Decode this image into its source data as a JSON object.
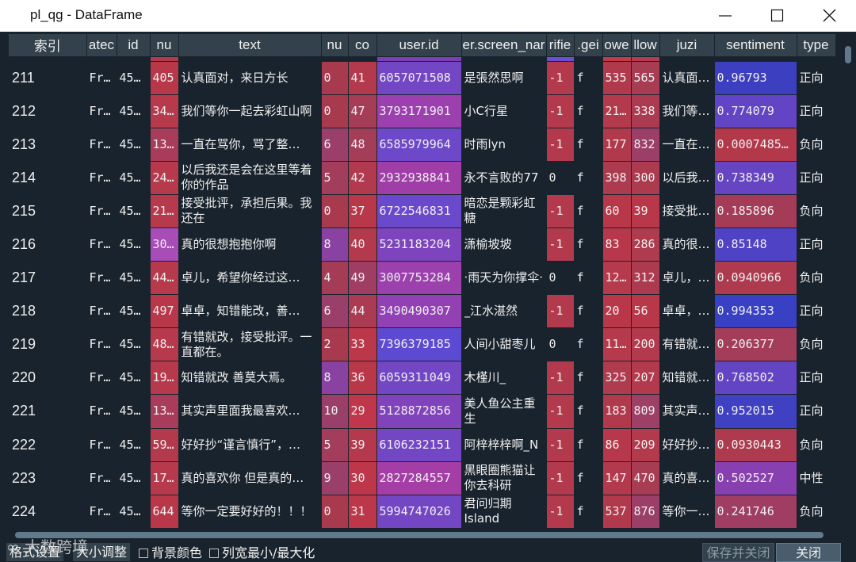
{
  "window": {
    "title": "pl_qg - DataFrame"
  },
  "table": {
    "headers": [
      "索引",
      "atec",
      "id",
      "nu",
      "text",
      "nu",
      "co",
      "user.id",
      "er.screen_nar",
      "rifie",
      ".gei",
      "owe",
      "llow",
      "juzi",
      "sentiment",
      "type"
    ],
    "top_row_colors": [
      "#19232d",
      "#19232d",
      "#19232d",
      "#b33a4c",
      "#19232d",
      "#19232d",
      "#19232d",
      "#7a3fb3",
      "#19232d",
      "#6a4fd0",
      "#19232d",
      "#c03c4a",
      "#b43b4f",
      "#19232d",
      "#19232d",
      "#19232d"
    ],
    "rows": [
      {
        "idx": "211",
        "c1": "Fr…",
        "c2": "45…",
        "c3": "405",
        "c4": "认真面对，来日方长",
        "c5": "0",
        "c6": "41",
        "c7": "6057071508",
        "c8": "是張然思啊",
        "c9": "-1",
        "c10": "f",
        "c11": "535",
        "c12": "565",
        "c13": "认真面…",
        "c14": "0.96793",
        "c15": "正向",
        "colors": {
          "c3": "#b8384a",
          "c5": "#a83a4e",
          "c6": "#b23a4c",
          "c7": "#7346c4",
          "c9": "#b23a4c",
          "c11": "#b03a4c",
          "c12": "#a83c52",
          "c14": "#3b3fc0"
        }
      },
      {
        "idx": "212",
        "c1": "Fr…",
        "c2": "45…",
        "c3": "34…",
        "c4": "我们等你一起去彩虹山啊",
        "c5": "0",
        "c6": "47",
        "c7": "3793171901",
        "c8": "小C行星",
        "c9": "-1",
        "c10": "f",
        "c11": "21…",
        "c12": "338",
        "c13": "我们等…",
        "c14": "0.774079",
        "c15": "正向",
        "colors": {
          "c3": "#b63a4c",
          "c5": "#a83a4e",
          "c6": "#a53d56",
          "c7": "#9c40b0",
          "c9": "#b23a4c",
          "c11": "#b23a4c",
          "c12": "#ab3b50",
          "c14": "#6245c4"
        }
      },
      {
        "idx": "213",
        "c1": "Fr…",
        "c2": "45…",
        "c3": "13…",
        "c4": "一直在骂你，骂了整…",
        "c5": "6",
        "c6": "48",
        "c7": "6585979964",
        "c8": "时雨lyn",
        "c9": "-1",
        "c10": "f",
        "c11": "177",
        "c12": "832",
        "c13": "一直在…",
        "c14": "0.0007485…",
        "c15": "负向",
        "colors": {
          "c3": "#a83c5a",
          "c5": "#9a3f6a",
          "c6": "#a33d58",
          "c7": "#6d48c8",
          "c9": "#b23a4c",
          "c11": "#b03a4c",
          "c12": "#9c3f68",
          "c14": "#b2384a"
        }
      },
      {
        "idx": "214",
        "c1": "Fr…",
        "c2": "45…",
        "c3": "24…",
        "c4": "以后我还是会在这里等着你的作品",
        "c5": "5",
        "c6": "42",
        "c7": "2932938841",
        "c8": "永不言败的77",
        "c9": "0",
        "c10": "f",
        "c11": "398",
        "c12": "300",
        "c13": "以后我…",
        "c14": "0.738349",
        "c15": "正向",
        "colors": {
          "c3": "#b63a4c",
          "c5": "#a23d5c",
          "c6": "#b13a4e",
          "c7": "#a03ea8",
          "c9": "#19232d",
          "c11": "#ac3b50",
          "c12": "#ac3b50",
          "c14": "#6745c2"
        }
      },
      {
        "idx": "215",
        "c1": "Fr…",
        "c2": "45…",
        "c3": "21…",
        "c4": "接受批评，承担后果。我还在",
        "c5": "0",
        "c6": "37",
        "c7": "6722546831",
        "c8": "暗恋是颗彩虹糖",
        "c9": "-1",
        "c10": "f",
        "c11": "60",
        "c12": "39",
        "c13": "接受批…",
        "c14": "0.185896",
        "c15": "负向",
        "colors": {
          "c3": "#b63a4c",
          "c5": "#a83a4e",
          "c6": "#b8384a",
          "c7": "#6a49cc",
          "c9": "#b23a4c",
          "c11": "#b8384a",
          "c12": "#b8384a",
          "c14": "#a43c58"
        }
      },
      {
        "idx": "216",
        "c1": "Fr…",
        "c2": "45…",
        "c3": "30…",
        "c4": "真的很想抱抱你啊",
        "c5": "8",
        "c6": "40",
        "c7": "5231183204",
        "c8": "潇榆坡坡",
        "c9": "-1",
        "c10": "f",
        "c11": "83",
        "c12": "286",
        "c13": "真的很…",
        "c14": "0.85148",
        "c15": "正向",
        "colors": {
          "c3": "#a84cb8",
          "c5": "#8a42a2",
          "c6": "#b23a4c",
          "c7": "#7e44bd",
          "c9": "#b23a4c",
          "c11": "#b6384a",
          "c12": "#ae3b4e",
          "c14": "#5042c4"
        }
      },
      {
        "idx": "217",
        "c1": "Fr…",
        "c2": "45…",
        "c3": "44…",
        "c4": "卓儿，希望你经过这…",
        "c5": "4",
        "c6": "49",
        "c7": "3007753284",
        "c8": "·雨天为你撑伞·",
        "c9": "0",
        "c10": "f",
        "c11": "12…",
        "c12": "312",
        "c13": "卓儿，…",
        "c14": "0.0940966",
        "c15": "负向",
        "colors": {
          "c3": "#b63a4c",
          "c5": "#a53c55",
          "c6": "#9f3e62",
          "c7": "#9c40ae",
          "c9": "#19232d",
          "c11": "#b43a4c",
          "c12": "#ad3b4f",
          "c14": "#ad3a4e"
        }
      },
      {
        "idx": "218",
        "c1": "Fr…",
        "c2": "45…",
        "c3": "497",
        "c4": "卓卓，知错能改，善…",
        "c5": "6",
        "c6": "44",
        "c7": "3490490307",
        "c8": "_江水湛然",
        "c9": "-1",
        "c10": "f",
        "c11": "20",
        "c12": "56",
        "c13": "卓卓，…",
        "c14": "0.994353",
        "c15": "正向",
        "colors": {
          "c3": "#b8384a",
          "c5": "#9a3f6a",
          "c6": "#ab3b52",
          "c7": "#9141b4",
          "c9": "#b23a4c",
          "c11": "#b8384a",
          "c12": "#b8384a",
          "c14": "#3840c4"
        }
      },
      {
        "idx": "219",
        "c1": "Fr…",
        "c2": "45…",
        "c3": "48…",
        "c4": "有错就改，接受批评。一直都在。",
        "c5": "2",
        "c6": "33",
        "c7": "7396379185",
        "c8": "人间小甜枣儿",
        "c9": "0",
        "c10": "f",
        "c11": "11…",
        "c12": "200",
        "c13": "有错就…",
        "c14": "0.206377",
        "c15": "负向",
        "colors": {
          "c3": "#b63a4c",
          "c5": "#a83a4e",
          "c6": "#bc374a",
          "c7": "#5c4ad2",
          "c9": "#19232d",
          "c11": "#b43a4c",
          "c12": "#b23a4c",
          "c14": "#a33d5a"
        }
      },
      {
        "idx": "220",
        "c1": "Fr…",
        "c2": "45…",
        "c3": "19…",
        "c4": "知错就改 善莫大焉。",
        "c5": "8",
        "c6": "36",
        "c7": "6059311049",
        "c8": "木槿川_",
        "c9": "-1",
        "c10": "f",
        "c11": "325",
        "c12": "207",
        "c13": "知错就…",
        "c14": "0.768502",
        "c15": "正向",
        "colors": {
          "c3": "#b63a4c",
          "c5": "#8a42a2",
          "c6": "#b8384a",
          "c7": "#7346c4",
          "c9": "#b23a4c",
          "c11": "#ae3b4e",
          "c12": "#b23a4c",
          "c14": "#6345c4"
        }
      },
      {
        "idx": "221",
        "c1": "Fr…",
        "c2": "45…",
        "c3": "13…",
        "c4": "其实声里面我最喜欢…",
        "c5": "10",
        "c6": "29",
        "c7": "5128872856",
        "c8": "美人鱼公主重生",
        "c9": "-1",
        "c10": "f",
        "c11": "183",
        "c12": "809",
        "c13": "其实声…",
        "c14": "0.952015",
        "c15": "正向",
        "colors": {
          "c3": "#a83c5a",
          "c5": "#9a3f6a",
          "c6": "#c0364a",
          "c7": "#8143bb",
          "c9": "#b23a4c",
          "c11": "#b03a4c",
          "c12": "#9e3f66",
          "c14": "#3f40c2"
        }
      },
      {
        "idx": "222",
        "c1": "Fr…",
        "c2": "45…",
        "c3": "59…",
        "c4": "好好抄“谨言慎行”，…",
        "c5": "5",
        "c6": "39",
        "c7": "6106232151",
        "c8": "阿梓梓梓啊_N",
        "c9": "-1",
        "c10": "f",
        "c11": "86",
        "c12": "209",
        "c13": "好好抄…",
        "c14": "0.0930443",
        "c15": "负向",
        "colors": {
          "c3": "#b23a4c",
          "c5": "#a23d5c",
          "c6": "#b4394c",
          "c7": "#7346c4",
          "c9": "#b23a4c",
          "c11": "#b6384a",
          "c12": "#b23a4c",
          "c14": "#ad3a4e"
        }
      },
      {
        "idx": "223",
        "c1": "Fr…",
        "c2": "45…",
        "c3": "17…",
        "c4": "真的喜欢你 但是真的…",
        "c5": "9",
        "c6": "30",
        "c7": "2827284557",
        "c8": "黑眼圈熊猫让你去科研",
        "c9": "-1",
        "c10": "f",
        "c11": "147",
        "c12": "470",
        "c13": "真的喜…",
        "c14": "0.502527",
        "c15": "中性",
        "colors": {
          "c3": "#b63a4c",
          "c5": "#9a3f6a",
          "c6": "#be364a",
          "c7": "#a43ea6",
          "c9": "#b23a4c",
          "c11": "#b23a4c",
          "c12": "#a83c52",
          "c14": "#8840b0"
        }
      },
      {
        "idx": "224",
        "c1": "Fr…",
        "c2": "45…",
        "c3": "644",
        "c4": "等你一定要好好的！！！",
        "c5": "0",
        "c6": "31",
        "c7": "5994747026",
        "c8": "君问归期Island",
        "c9": "-1",
        "c10": "f",
        "c11": "537",
        "c12": "876",
        "c13": "等你一…",
        "c14": "0.241746",
        "c15": "负向",
        "colors": {
          "c3": "#b8384a",
          "c5": "#a83a4e",
          "c6": "#bc374a",
          "c7": "#7346c4",
          "c9": "#b23a4c",
          "c11": "#b03a4c",
          "c12": "#9c3f68",
          "c14": "#9f3e62"
        }
      }
    ]
  },
  "bottom": {
    "format_btn": "格式设置",
    "resize_btn": "大小调整",
    "bg_color_label": "背景颜色",
    "colwidth_label": "列宽最小/最大化",
    "save_close_btn": "保存并关闭",
    "close_btn": "关闭",
    "watermark": "大数跨境"
  }
}
